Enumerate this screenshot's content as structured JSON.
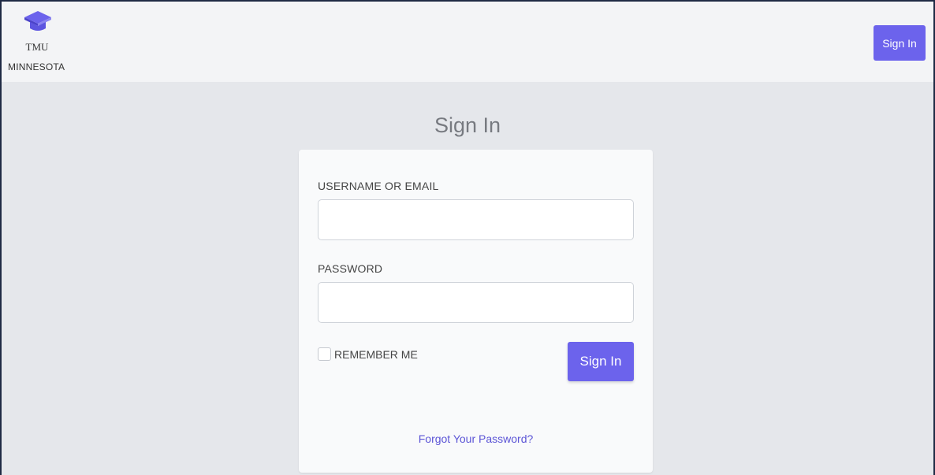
{
  "brand": {
    "name": "TMU",
    "location": "MINNESOTA",
    "icon": "graduation-cap-icon",
    "accent_color": "#6c63ec"
  },
  "nav": {
    "signin_label": "Sign In"
  },
  "page": {
    "title": "Sign In"
  },
  "form": {
    "username_label": "USERNAME OR EMAIL",
    "username_value": "",
    "password_label": "PASSWORD",
    "password_value": "",
    "remember_label": "REMEMBER ME",
    "remember_checked": false,
    "submit_label": "Sign In",
    "forgot_label": "Forgot Your Password?"
  }
}
